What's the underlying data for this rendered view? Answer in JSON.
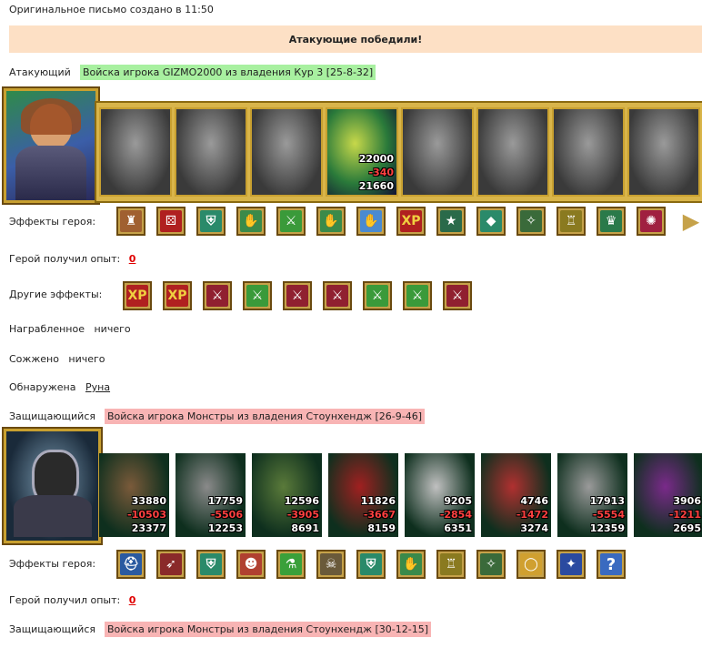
{
  "header": {
    "created": "Оригинальное письмо создано в 11:50"
  },
  "result": {
    "text": "Атакующие победили!"
  },
  "attacker": {
    "label": "Атакующий",
    "army": "Войска игрока GIZMO2000 из владения Кур 3 [25-8-32]",
    "units": [
      {
        "name": "unit-1",
        "state": "gray"
      },
      {
        "name": "unit-2",
        "state": "gray"
      },
      {
        "name": "unit-3",
        "state": "gray"
      },
      {
        "name": "unit-4",
        "state": "color",
        "count": "22000",
        "loss": "-340",
        "remain": "21660"
      },
      {
        "name": "unit-5",
        "state": "gray"
      },
      {
        "name": "unit-6",
        "state": "gray"
      },
      {
        "name": "unit-7",
        "state": "gray"
      },
      {
        "name": "unit-8",
        "state": "gray"
      }
    ],
    "effects_label": "Эффекты героя:",
    "effects": [
      "tower-icon",
      "dice-icon",
      "shield-icon",
      "handshake-icon",
      "sword-icon",
      "handshake-icon",
      "hand-icon",
      "xp-icon",
      "xp-figure-icon",
      "crystal-icon",
      "amulet-icon",
      "armor-icon",
      "helm-icon",
      "rune-icon",
      "arrow-right-icon"
    ],
    "effects_text": {
      "xp": "XP"
    },
    "exp_label": "Герой получил опыт:",
    "exp_value": "0",
    "other_effects_label": "Другие эффекты:",
    "other_effects": [
      "xp-icon",
      "xp-icon",
      "fist-sword-icon",
      "sword-icon",
      "fist-sword-icon",
      "fist-sword-icon",
      "sword-icon",
      "sword-icon",
      "fist-sword-icon"
    ],
    "looted_label": "Награбленное",
    "looted_value": "ничего",
    "burned_label": "Сожжено",
    "burned_value": "ничего",
    "found_label": "Обнаружена",
    "found_value": "Руна"
  },
  "defender1": {
    "label": "Защищающийся",
    "army": "Войска игрока Монстры из владения Стоунхендж [26-9-46]",
    "units": [
      {
        "name": "monster-1",
        "count": "33880",
        "loss": "-10503",
        "remain": "23377",
        "color": "#7a5a3a"
      },
      {
        "name": "monster-2",
        "count": "17759",
        "loss": "-5506",
        "remain": "12253",
        "color": "#8a8a8a"
      },
      {
        "name": "monster-3",
        "count": "12596",
        "loss": "-3905",
        "remain": "8691",
        "color": "#5a7a3a"
      },
      {
        "name": "monster-4",
        "count": "11826",
        "loss": "-3667",
        "remain": "8159",
        "color": "#a02020"
      },
      {
        "name": "monster-5",
        "count": "9205",
        "loss": "-2854",
        "remain": "6351",
        "color": "#c0c0c0"
      },
      {
        "name": "monster-6",
        "count": "4746",
        "loss": "-1472",
        "remain": "3274",
        "color": "#b03030"
      },
      {
        "name": "monster-7",
        "count": "17913",
        "loss": "-5554",
        "remain": "12359",
        "color": "#9a9a9a"
      },
      {
        "name": "monster-8",
        "count": "3906",
        "loss": "-1211",
        "remain": "2695",
        "color": "#7a2a8a"
      }
    ],
    "effects_label": "Эффекты героя:",
    "effects": [
      "helmet-icon",
      "arrows-icon",
      "shield-icon",
      "face-icon",
      "potion-icon",
      "skull-icon",
      "shield-icon",
      "handshake-icon",
      "armor-icon",
      "amulet-icon",
      "ring-icon",
      "staff-icon",
      "question-icon"
    ],
    "effects_text": {
      "question": "?"
    },
    "exp_label": "Герой получил опыт:",
    "exp_value": "0"
  },
  "defender2": {
    "label": "Защищающийся",
    "army": "Войска игрока Монстры из владения Стоунхендж [30-12-15]"
  },
  "colors": {
    "win_banner": "#fde0c5",
    "attacker_tag": "#a8f0a0",
    "defender_tag": "#f8b4b4",
    "frame": "#c8a030",
    "loss": "#ff4040"
  }
}
